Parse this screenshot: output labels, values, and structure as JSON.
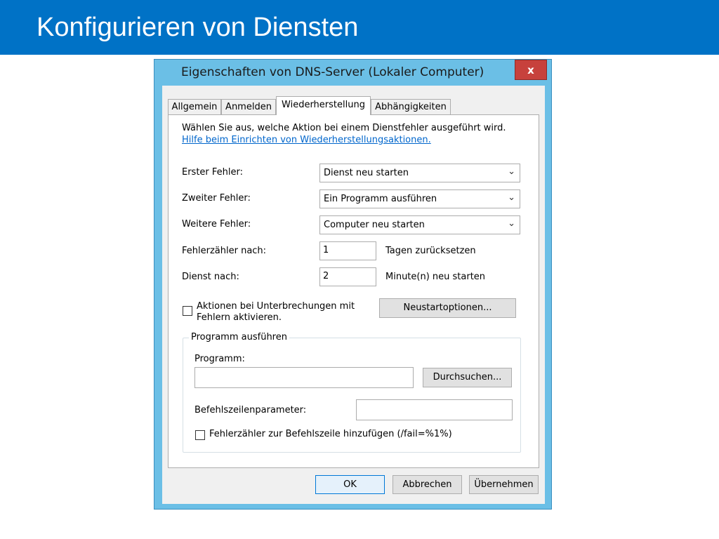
{
  "slide": {
    "title": "Konfigurieren von Diensten",
    "banner_color": "#0072c6"
  },
  "dialog": {
    "title": "Eigenschaften von DNS-Server (Lokaler Computer)",
    "close_label": "x",
    "tabs": [
      {
        "label": "Allgemein",
        "active": false
      },
      {
        "label": "Anmelden",
        "active": false
      },
      {
        "label": "Wiederherstellung",
        "active": true
      },
      {
        "label": "Abhängigkeiten",
        "active": false
      }
    ],
    "intro": "Wählen Sie aus, welche Aktion bei einem Dienstfehler ausgeführt wird.",
    "help_link": "Hilfe beim Einrichten von Wiederherstellungsaktionen.",
    "first_failure": {
      "label": "Erster Fehler:",
      "value": "Dienst neu starten"
    },
    "second_failure": {
      "label": "Zweiter Fehler:",
      "value": "Ein Programm ausführen"
    },
    "subsequent_failures": {
      "label": "Weitere Fehler:",
      "value": "Computer neu starten"
    },
    "reset_count": {
      "label": "Fehlerzähler nach:",
      "value": "1",
      "unit": "Tagen zurücksetzen"
    },
    "restart_after": {
      "label": "Dienst nach:",
      "value": "2",
      "unit": "Minute(n) neu starten"
    },
    "enable_actions": {
      "label_line1": "Aktionen bei Unterbrechungen mit",
      "label_line2": "Fehlern aktivieren.",
      "checked": false
    },
    "restart_options_button": "Neustartoptionen...",
    "run_program": {
      "legend": "Programm ausführen",
      "program_label": "Programm:",
      "program_value": "",
      "browse_button": "Durchsuchen...",
      "params_label": "Befehlszeilenparameter:",
      "params_value": "",
      "append_fail_count": {
        "label": "Fehlerzähler zur Befehlszeile hinzufügen (/fail=%1%)",
        "checked": false
      }
    },
    "buttons": {
      "ok": "OK",
      "cancel": "Abbrechen",
      "apply": "Übernehmen"
    }
  }
}
